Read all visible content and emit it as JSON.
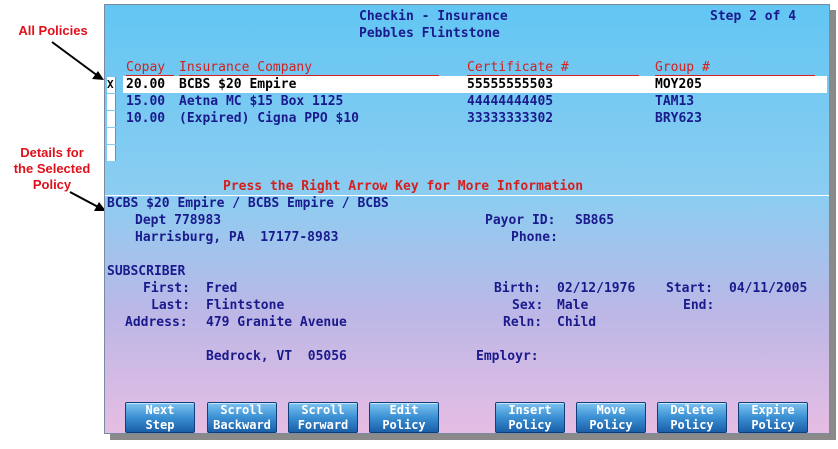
{
  "callouts": {
    "all_policies": "All Policies",
    "details": "Details for\nthe Selected\nPolicy"
  },
  "header": {
    "title": "Checkin - Insurance",
    "patient": "Pebbles Flintstone",
    "step": "Step 2 of 4"
  },
  "columns": {
    "copay": "Copay",
    "company": "Insurance Company",
    "certificate": "Certificate #",
    "group": "Group #"
  },
  "policies": [
    {
      "selected_mark": "X",
      "copay": "20.00",
      "company": "BCBS $20 Empire",
      "certificate": "55555555503",
      "group": "MOY205"
    },
    {
      "copay": "15.00",
      "company": "Aetna MC $15 Box 1125",
      "certificate": "44444444405",
      "group": "TAM13"
    },
    {
      "copay": "10.00",
      "company": "(Expired) Cigna PPO $10",
      "certificate": "33333333302",
      "group": "BRY623"
    }
  ],
  "hint": "Press the Right Arrow Key for More Information",
  "details": {
    "line1": "BCBS $20 Empire / BCBS Empire / BCBS",
    "dept": "Dept 778983",
    "city": "Harrisburg, PA  17177-8983",
    "payor_label": "Payor ID:",
    "payor_value": "SB865",
    "phone_label": "Phone:",
    "phone_value": ""
  },
  "subscriber": {
    "heading": "SUBSCRIBER",
    "first_label": "First:",
    "first_value": "Fred",
    "last_label": "Last:",
    "last_value": "Flintstone",
    "address_label": "Address:",
    "address_value": "479 Granite Avenue",
    "address_city": "Bedrock, VT  05056",
    "birth_label": "Birth:",
    "birth_value": "02/12/1976",
    "start_label": "Start:",
    "start_value": "04/11/2005",
    "sex_label": "Sex:",
    "sex_value": "Male",
    "end_label": "End:",
    "end_value": "",
    "reln_label": "Reln:",
    "reln_value": "Child",
    "employer_label": "Employr:",
    "employer_value": ""
  },
  "buttons": {
    "next": "Next\nStep",
    "scroll_backward": "Scroll\nBackward",
    "scroll_forward": "Scroll\nForward",
    "edit": "Edit\nPolicy",
    "insert": "Insert\nPolicy",
    "move": "Move\nPolicy",
    "delete": "Delete\nPolicy",
    "expire": "Expire\nPolicy"
  },
  "colors": {
    "text": "#1a1a8c",
    "headers": "#d4201e",
    "callout": "#e0101a",
    "button": "#2a78c4"
  }
}
